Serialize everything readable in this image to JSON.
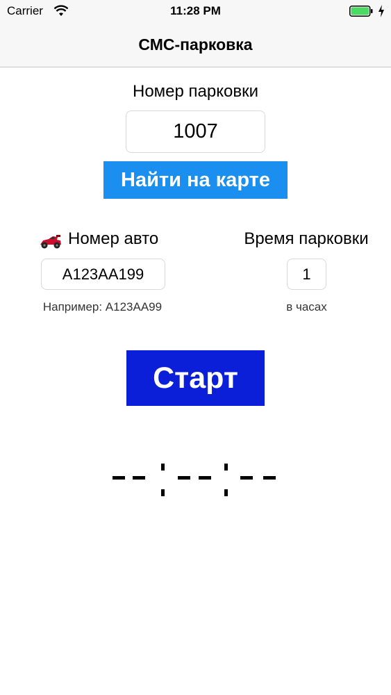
{
  "status_bar": {
    "carrier": "Carrier",
    "time": "11:28 PM",
    "icons": [
      "wifi-icon",
      "battery-icon",
      "charging-bolt-icon"
    ],
    "battery_color": "#4cd964"
  },
  "nav": {
    "title": "СМС-парковка"
  },
  "parking": {
    "label": "Номер парковки",
    "value": "1007",
    "find_button_label": "Найти на карте"
  },
  "car": {
    "icon": "race-car-icon",
    "label": "Номер авто",
    "value": "А123АА199",
    "example": "Например: А123АА99"
  },
  "duration": {
    "label": "Время парковки",
    "value": "1",
    "unit": "в часах"
  },
  "start_button_label": "Старт",
  "timer": {
    "display": "--:--:--"
  },
  "colors": {
    "find_button": "#1a8ff0",
    "start_button": "#0b1ed8",
    "bar_background": "#f7f7f7"
  }
}
